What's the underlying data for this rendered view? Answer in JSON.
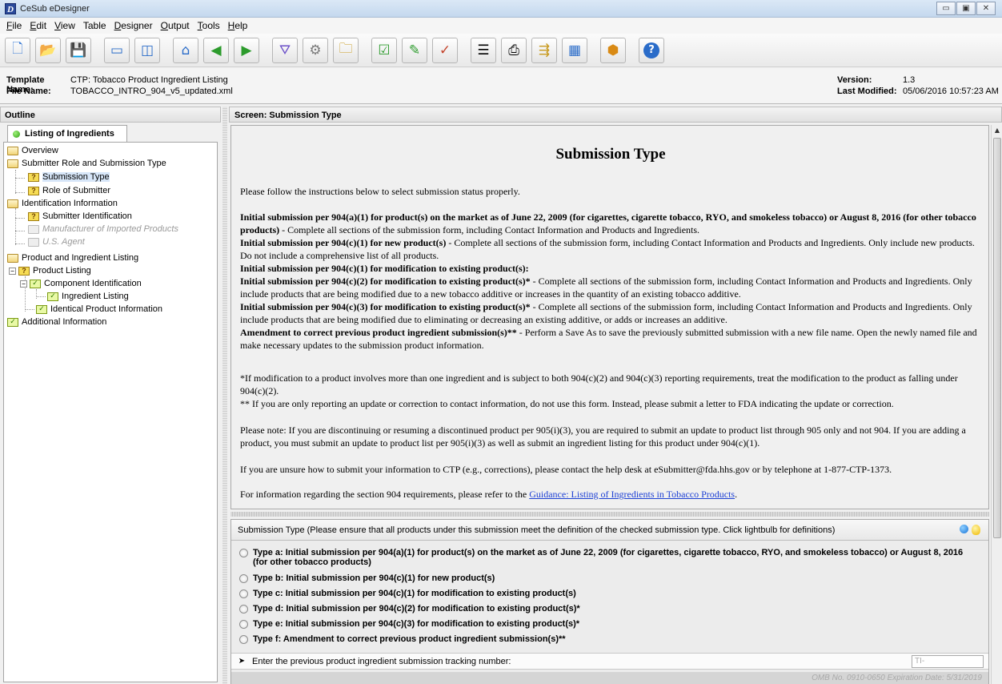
{
  "app": {
    "title": "CeSub eDesigner",
    "icon_letter": "D"
  },
  "window_controls": {
    "minimize": "▭",
    "maximize": "▣",
    "close": "✕"
  },
  "menu": [
    {
      "label": "File",
      "ul": "F",
      "rest": "ile"
    },
    {
      "label": "Edit",
      "ul": "E",
      "rest": "dit"
    },
    {
      "label": "View",
      "ul": "V",
      "rest": "iew"
    },
    {
      "label": "Table",
      "ul": "T",
      "rest": "able"
    },
    {
      "label": "Designer",
      "ul": "D",
      "rest": "esigner"
    },
    {
      "label": "Output",
      "ul": "O",
      "rest": "utput"
    },
    {
      "label": "Tools",
      "ul": "T",
      "rest": "ools"
    },
    {
      "label": "Help",
      "ul": "H",
      "rest": "elp"
    }
  ],
  "toolbar": [
    {
      "name": "new-document-icon",
      "glyph": "🗋"
    },
    {
      "name": "open-folder-icon",
      "glyph": "📂"
    },
    {
      "name": "save-icon",
      "glyph": "💾"
    },
    {
      "name": "window-icon",
      "glyph": "▭"
    },
    {
      "name": "split-view-icon",
      "glyph": "◫"
    },
    {
      "name": "home-icon",
      "glyph": "⌂"
    },
    {
      "name": "back-arrow-icon",
      "glyph": "◀"
    },
    {
      "name": "forward-arrow-icon",
      "glyph": "▶"
    },
    {
      "name": "filter-icon",
      "glyph": "⛛"
    },
    {
      "name": "settings-gears-icon",
      "glyph": "⚙"
    },
    {
      "name": "folder-open-icon",
      "glyph": "🗀"
    },
    {
      "name": "checklist-icon",
      "glyph": "☑"
    },
    {
      "name": "edit-form-icon",
      "glyph": "✎"
    },
    {
      "name": "review-form-icon",
      "glyph": "✓"
    },
    {
      "name": "document-list-icon",
      "glyph": "☰"
    },
    {
      "name": "print-preview-icon",
      "glyph": "⎙"
    },
    {
      "name": "output-icon",
      "glyph": "⇶"
    },
    {
      "name": "calculator-icon",
      "glyph": "▦"
    },
    {
      "name": "package-icon",
      "glyph": "⬢"
    },
    {
      "name": "help-icon",
      "glyph": "?"
    }
  ],
  "template_info": {
    "template_name_label": "Template Name:",
    "template_name": "CTP: Tobacco Product Ingredient Listing",
    "file_name_label": "File Name:",
    "file_name": "TOBACCO_INTRO_904_v5_updated.xml",
    "version_label": "Version:",
    "version": "1.3",
    "last_modified_label": "Last Modified:",
    "last_modified": "05/06/2016 10:57:23 AM"
  },
  "outline": {
    "header": "Outline",
    "tab": "Listing of Ingredients",
    "nodes": [
      {
        "label": "Overview"
      },
      {
        "label": "Submitter Role and Submission Type"
      },
      {
        "label": "Submission Type"
      },
      {
        "label": "Role of Submitter"
      },
      {
        "label": "Identification Information"
      },
      {
        "label": "Submitter Identification"
      },
      {
        "label": "Manufacturer of Imported Products"
      },
      {
        "label": "U.S. Agent"
      },
      {
        "label": "Product and Ingredient Listing"
      },
      {
        "label": "Product Listing"
      },
      {
        "label": "Component Identification"
      },
      {
        "label": "Ingredient Listing"
      },
      {
        "label": "Identical Product Information"
      },
      {
        "label": "Additional Information"
      }
    ]
  },
  "screen": {
    "header": "Screen: Submission Type",
    "title": "Submission Type",
    "intro": "Please follow the instructions below to select submission status properly.",
    "p1_bold": "Initial submission per 904(a)(1) for product(s) on the market as of June 22, 2009 (for cigarettes, cigarette tobacco, RYO, and smokeless tobacco) or August 8, 2016 (for other tobacco products)",
    "p1_rest": " - Complete all sections of the submission form, including Contact Information and Products and Ingredients.",
    "p2_bold": "Initial submission per 904(c)(1) for new product(s)",
    "p2_rest": " - Complete all sections of the submission form, including Contact Information and Products and Ingredients. Only include new products. Do not include a comprehensive list of all products.",
    "p3_bold": "Initial submission per 904(c)(1) for modification to existing product(s):",
    "p4_bold": "Initial submission per 904(c)(2) for modification to existing product(s)*",
    "p4_rest": " - Complete all sections of the submission form, including Contact Information and Products and Ingredients. Only include products that are being modified due to a new tobacco additive or increases in the quantity of an existing tobacco additive.",
    "p5_bold": "Initial submission per 904(c)(3) for modification to existing product(s)*",
    "p5_rest": " - Complete all sections of the submission form, including Contact Information and Products and Ingredients. Only include products that are being modified due to eliminating or decreasing an existing additive, or adds or increases an additive.",
    "p6_bold": "Amendment to correct previous product ingredient submission(s)**",
    "p6_rest": " - Perform a Save As to save the previously submitted submission with a new file name. Open the newly named file and make necessary updates to the submission product information.",
    "note1": "*If modification to a product involves more than one ingredient and is subject to both 904(c)(2) and 904(c)(3) reporting requirements, treat the modification to the product as falling under 904(c)(2).",
    "note2": "** If you are only reporting an update or correction to contact information, do not use this form. Instead, please submit a letter to FDA indicating the update or correction.",
    "note3": "Please note: If you are discontinuing or resuming a discontinued product per 905(i)(3), you are required to submit an update to product list through 905 only and not 904. If you are adding a product, you must submit an update to product list per 905(i)(3) as well as submit an ingredient listing for this product under 904(c)(1).",
    "note4": "If you are unsure how to submit your information to CTP (e.g., corrections), please contact the help desk at eSubmitter@fda.hhs.gov or by telephone at 1-877-CTP-1373.",
    "note5_text": "For information regarding the section 904 requirements, please refer to the ",
    "note5_link": "Guidance: Listing of Ingredients in Tobacco Products",
    "note5_end": "."
  },
  "form": {
    "question": "Submission Type (Please ensure that all products under this submission meet the definition of the checked submission type. Click lightbulb for definitions)",
    "options": [
      {
        "label": "Type a: Initial submission per 904(a)(1) for product(s) on the market as of June 22, 2009 (for cigarettes, cigarette tobacco, RYO, and smokeless tobacco) or August 8, 2016 (for other tobacco products)",
        "selected": false
      },
      {
        "label": "Type b: Initial submission per 904(c)(1) for new product(s)",
        "selected": false
      },
      {
        "label": "Type c: Initial submission per 904(c)(1) for modification to existing product(s)",
        "selected": false
      },
      {
        "label": "Type d: Initial submission per 904(c)(2) for modification to existing product(s)*",
        "selected": false
      },
      {
        "label": "Type e: Initial submission per 904(c)(3) for modification to existing product(s)*",
        "selected": false
      },
      {
        "label": "Type f: Amendment to correct previous product ingredient submission(s)**",
        "selected": false
      }
    ],
    "tracking_label": "Enter the previous product ingredient submission tracking number:",
    "tracking_value": "TI-",
    "footer": "OMB No. 0910-0650  Expiration Date: 5/31/2019"
  },
  "colors": {
    "link": "#1c3fd4",
    "selection": "#d7e6f8",
    "status_green": "#2e9c12"
  }
}
